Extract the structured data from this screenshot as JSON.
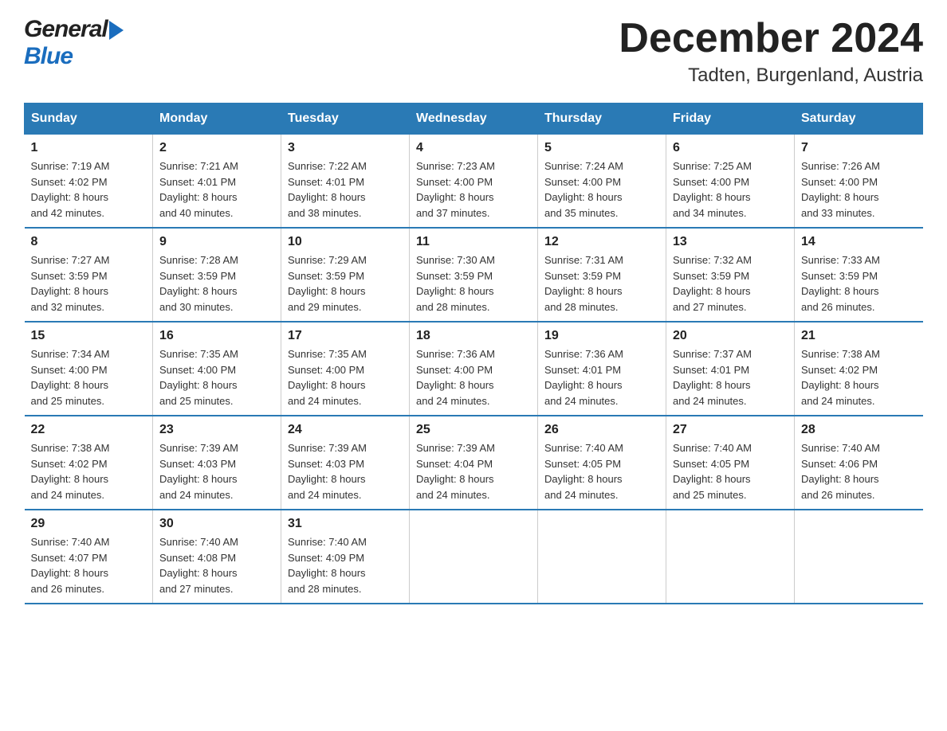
{
  "header": {
    "logo_general": "General",
    "logo_blue": "Blue",
    "month_title": "December 2024",
    "location": "Tadten, Burgenland, Austria"
  },
  "weekdays": [
    "Sunday",
    "Monday",
    "Tuesday",
    "Wednesday",
    "Thursday",
    "Friday",
    "Saturday"
  ],
  "weeks": [
    [
      {
        "day": "1",
        "sunrise": "7:19 AM",
        "sunset": "4:02 PM",
        "daylight": "8 hours and 42 minutes."
      },
      {
        "day": "2",
        "sunrise": "7:21 AM",
        "sunset": "4:01 PM",
        "daylight": "8 hours and 40 minutes."
      },
      {
        "day": "3",
        "sunrise": "7:22 AM",
        "sunset": "4:01 PM",
        "daylight": "8 hours and 38 minutes."
      },
      {
        "day": "4",
        "sunrise": "7:23 AM",
        "sunset": "4:00 PM",
        "daylight": "8 hours and 37 minutes."
      },
      {
        "day": "5",
        "sunrise": "7:24 AM",
        "sunset": "4:00 PM",
        "daylight": "8 hours and 35 minutes."
      },
      {
        "day": "6",
        "sunrise": "7:25 AM",
        "sunset": "4:00 PM",
        "daylight": "8 hours and 34 minutes."
      },
      {
        "day": "7",
        "sunrise": "7:26 AM",
        "sunset": "4:00 PM",
        "daylight": "8 hours and 33 minutes."
      }
    ],
    [
      {
        "day": "8",
        "sunrise": "7:27 AM",
        "sunset": "3:59 PM",
        "daylight": "8 hours and 32 minutes."
      },
      {
        "day": "9",
        "sunrise": "7:28 AM",
        "sunset": "3:59 PM",
        "daylight": "8 hours and 30 minutes."
      },
      {
        "day": "10",
        "sunrise": "7:29 AM",
        "sunset": "3:59 PM",
        "daylight": "8 hours and 29 minutes."
      },
      {
        "day": "11",
        "sunrise": "7:30 AM",
        "sunset": "3:59 PM",
        "daylight": "8 hours and 28 minutes."
      },
      {
        "day": "12",
        "sunrise": "7:31 AM",
        "sunset": "3:59 PM",
        "daylight": "8 hours and 28 minutes."
      },
      {
        "day": "13",
        "sunrise": "7:32 AM",
        "sunset": "3:59 PM",
        "daylight": "8 hours and 27 minutes."
      },
      {
        "day": "14",
        "sunrise": "7:33 AM",
        "sunset": "3:59 PM",
        "daylight": "8 hours and 26 minutes."
      }
    ],
    [
      {
        "day": "15",
        "sunrise": "7:34 AM",
        "sunset": "4:00 PM",
        "daylight": "8 hours and 25 minutes."
      },
      {
        "day": "16",
        "sunrise": "7:35 AM",
        "sunset": "4:00 PM",
        "daylight": "8 hours and 25 minutes."
      },
      {
        "day": "17",
        "sunrise": "7:35 AM",
        "sunset": "4:00 PM",
        "daylight": "8 hours and 24 minutes."
      },
      {
        "day": "18",
        "sunrise": "7:36 AM",
        "sunset": "4:00 PM",
        "daylight": "8 hours and 24 minutes."
      },
      {
        "day": "19",
        "sunrise": "7:36 AM",
        "sunset": "4:01 PM",
        "daylight": "8 hours and 24 minutes."
      },
      {
        "day": "20",
        "sunrise": "7:37 AM",
        "sunset": "4:01 PM",
        "daylight": "8 hours and 24 minutes."
      },
      {
        "day": "21",
        "sunrise": "7:38 AM",
        "sunset": "4:02 PM",
        "daylight": "8 hours and 24 minutes."
      }
    ],
    [
      {
        "day": "22",
        "sunrise": "7:38 AM",
        "sunset": "4:02 PM",
        "daylight": "8 hours and 24 minutes."
      },
      {
        "day": "23",
        "sunrise": "7:39 AM",
        "sunset": "4:03 PM",
        "daylight": "8 hours and 24 minutes."
      },
      {
        "day": "24",
        "sunrise": "7:39 AM",
        "sunset": "4:03 PM",
        "daylight": "8 hours and 24 minutes."
      },
      {
        "day": "25",
        "sunrise": "7:39 AM",
        "sunset": "4:04 PM",
        "daylight": "8 hours and 24 minutes."
      },
      {
        "day": "26",
        "sunrise": "7:40 AM",
        "sunset": "4:05 PM",
        "daylight": "8 hours and 24 minutes."
      },
      {
        "day": "27",
        "sunrise": "7:40 AM",
        "sunset": "4:05 PM",
        "daylight": "8 hours and 25 minutes."
      },
      {
        "day": "28",
        "sunrise": "7:40 AM",
        "sunset": "4:06 PM",
        "daylight": "8 hours and 26 minutes."
      }
    ],
    [
      {
        "day": "29",
        "sunrise": "7:40 AM",
        "sunset": "4:07 PM",
        "daylight": "8 hours and 26 minutes."
      },
      {
        "day": "30",
        "sunrise": "7:40 AM",
        "sunset": "4:08 PM",
        "daylight": "8 hours and 27 minutes."
      },
      {
        "day": "31",
        "sunrise": "7:40 AM",
        "sunset": "4:09 PM",
        "daylight": "8 hours and 28 minutes."
      },
      null,
      null,
      null,
      null
    ]
  ],
  "labels": {
    "sunrise": "Sunrise:",
    "sunset": "Sunset:",
    "daylight": "Daylight:"
  }
}
